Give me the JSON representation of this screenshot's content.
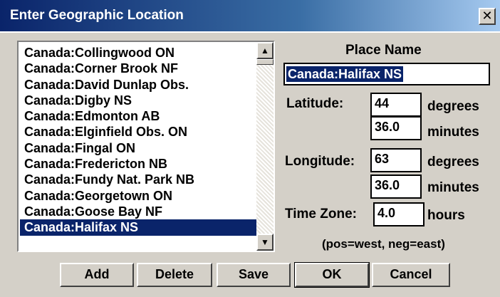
{
  "window": {
    "title": "Enter Geographic Location",
    "close_glyph": "✕"
  },
  "locations": [
    "Canada:Collingwood ON",
    "Canada:Corner Brook NF",
    "Canada:David Dunlap Obs.",
    "Canada:Digby NS",
    "Canada:Edmonton AB",
    "Canada:Elginfield Obs. ON",
    "Canada:Fingal ON",
    "Canada:Fredericton NB",
    "Canada:Fundy Nat. Park NB",
    "Canada:Georgetown ON",
    "Canada:Goose Bay NF",
    "Canada:Halifax NS"
  ],
  "selected_location": "Canada:Halifax NS",
  "form": {
    "place_name_label": "Place Name",
    "place_name_value": "Canada:Halifax NS",
    "latitude_label": "Latitude:",
    "latitude_degrees": "44",
    "latitude_minutes": "36.0",
    "longitude_label": "Longitude:",
    "longitude_degrees": "63",
    "longitude_minutes": "36.0",
    "degrees_unit": "degrees",
    "minutes_unit": "minutes",
    "timezone_label": "Time Zone:",
    "timezone_value": "4.0",
    "hours_unit": "hours",
    "sign_note": "(pos=west, neg=east)"
  },
  "buttons": {
    "add": "Add",
    "delete": "Delete",
    "save": "Save",
    "ok": "OK",
    "cancel": "Cancel"
  },
  "icons": {
    "scroll_up": "▲",
    "scroll_down": "▼"
  },
  "colors": {
    "selection": "#0a246a",
    "title_gradient_start": "#0a246a",
    "title_gradient_end": "#a6caf0",
    "face": "#d4d0c8"
  }
}
